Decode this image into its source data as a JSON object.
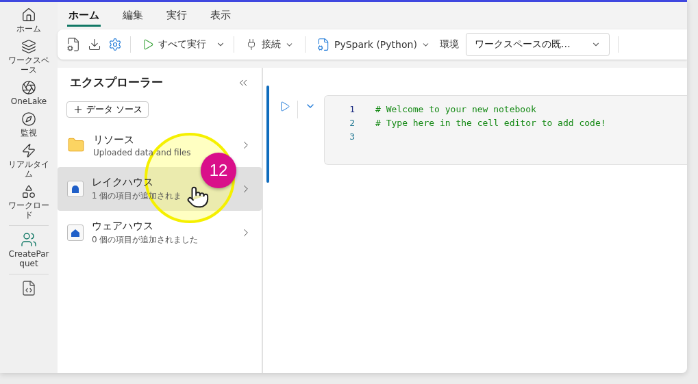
{
  "rail": {
    "items": [
      {
        "label": "ホーム",
        "kind": "home"
      },
      {
        "label": "ワークスペース",
        "kind": "workspaces"
      },
      {
        "label": "OneLake",
        "kind": "onelake"
      },
      {
        "label": "監視",
        "kind": "monitor"
      },
      {
        "label": "リアルタイム",
        "kind": "realtime"
      },
      {
        "label": "ワークロード",
        "kind": "workload"
      }
    ],
    "workspace": {
      "label": "CreateParquet"
    }
  },
  "tabs": [
    {
      "label": "ホーム",
      "selected": true
    },
    {
      "label": "編集",
      "selected": false
    },
    {
      "label": "実行",
      "selected": false
    },
    {
      "label": "表示",
      "selected": false
    }
  ],
  "toolbar": {
    "run_all": "すべて実行",
    "connect": "接続",
    "language": "PySpark (Python)",
    "environment_label": "環境",
    "environment_value": "ワークスペースの既…"
  },
  "explorer": {
    "title": "エクスプローラー",
    "add_button": "データ ソース",
    "items": [
      {
        "kind": "resources",
        "title": "リソース",
        "subtitle": "Uploaded data and files",
        "selected": false
      },
      {
        "kind": "lakehouse",
        "title": "レイクハウス",
        "subtitle": "1 個の項目が追加されま",
        "selected": true
      },
      {
        "kind": "warehouse",
        "title": "ウェアハウス",
        "subtitle": "0 個の項目が追加されました",
        "selected": false
      }
    ]
  },
  "cell": {
    "lines": [
      {
        "number": "1",
        "code": "# Welcome to your new notebook"
      },
      {
        "number": "2",
        "code": "# Type here in the cell editor to add code!"
      },
      {
        "number": "3"
      }
    ]
  },
  "step_badge": "12"
}
